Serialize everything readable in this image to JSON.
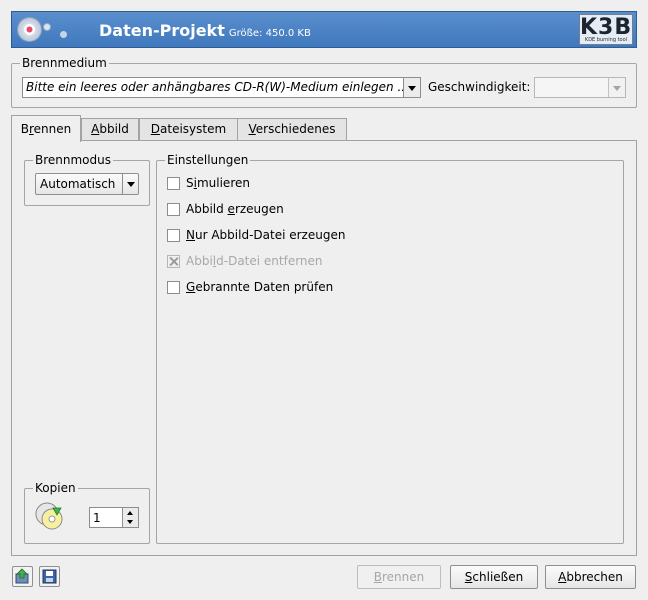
{
  "header": {
    "title": "Daten-Projekt",
    "size_label": "Größe: 450.0 KB",
    "logo_text": "K3B",
    "logo_subtext": "KDE burning tool"
  },
  "medium": {
    "legend": "Brennmedium",
    "selected": "Bitte ein leeres oder anhängbares CD-R(W)-Medium einlegen ...",
    "speed_label": "Geschwindigkeit:",
    "speed_value": ""
  },
  "tabs": [
    {
      "pre": "B",
      "ul": "r",
      "post": "ennen"
    },
    {
      "pre": "",
      "ul": "A",
      "post": "bbild"
    },
    {
      "pre": "",
      "ul": "D",
      "post": "ateisystem"
    },
    {
      "pre": "",
      "ul": "V",
      "post": "erschiedenes"
    }
  ],
  "brennmodus": {
    "legend": "Brennmodus",
    "value": "Automatisch"
  },
  "einstellungen": {
    "legend": "Einstellungen",
    "options": [
      {
        "pre": "S",
        "ul": "i",
        "post": "mulieren"
      },
      {
        "pre": "Abbild ",
        "ul": "e",
        "post": "rzeugen"
      },
      {
        "pre": "",
        "ul": "N",
        "post": "ur Abbild-Datei erzeugen"
      },
      {
        "pre": "Abbi",
        "ul": "l",
        "post": "d-Datei entfernen"
      },
      {
        "pre": "",
        "ul": "G",
        "post": "ebrannte Daten prüfen"
      }
    ]
  },
  "kopien": {
    "legend": "Kopien",
    "value": "1"
  },
  "buttons": {
    "brennen": {
      "pre": "",
      "ul": "B",
      "post": "rennen"
    },
    "schliessen": {
      "pre": "",
      "ul": "S",
      "post": "chließen"
    },
    "abbrechen": {
      "pre": "",
      "ul": "A",
      "post": "bbrechen"
    }
  },
  "icons": {
    "load": "load-settings-icon",
    "save": "save-settings-icon",
    "copies": "cd-copies-icon",
    "header": "cd-disc-icon"
  }
}
